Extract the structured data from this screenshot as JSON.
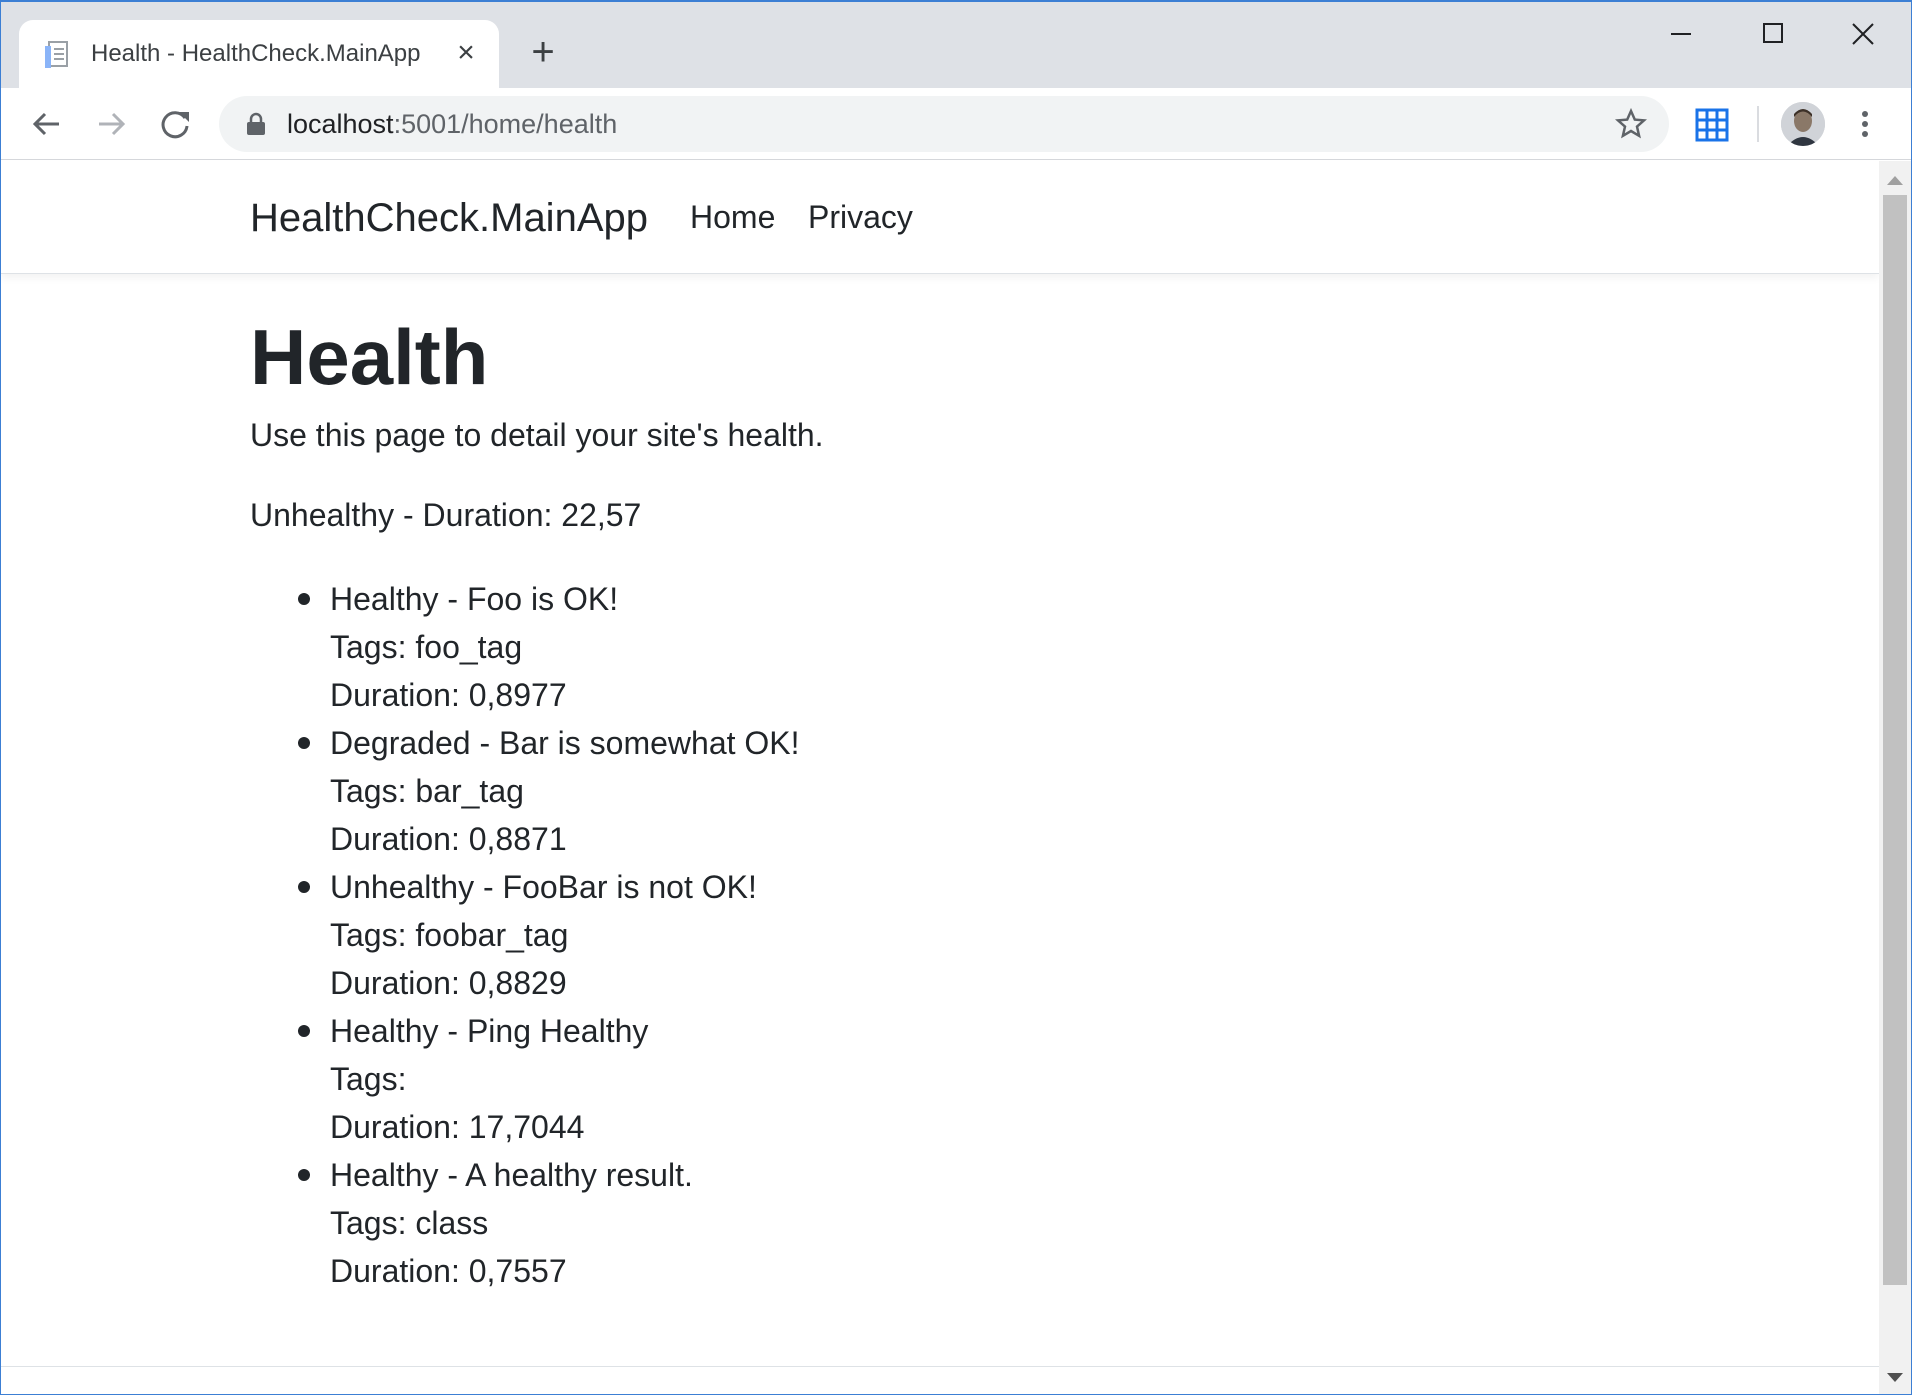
{
  "browser": {
    "tab": {
      "title": "Health - HealthCheck.MainApp",
      "favicon": "page-icon"
    },
    "url": {
      "host": "localhost",
      "path": ":5001/home/health"
    },
    "icons": [
      "back-icon",
      "forward-icon",
      "reload-icon",
      "lock-icon",
      "star-icon",
      "extension-grid-icon",
      "avatar",
      "menu-icon"
    ]
  },
  "navbar": {
    "brand": "HealthCheck.MainApp",
    "links": [
      {
        "label": "Home"
      },
      {
        "label": "Privacy"
      }
    ]
  },
  "page": {
    "title": "Health",
    "lead": "Use this page to detail your site's health.",
    "overall": "Unhealthy - Duration: 22,57",
    "checks": [
      {
        "status_line": "Healthy - Foo is OK!",
        "tags_line": "Tags: foo_tag",
        "duration_line": "Duration: 0,8977"
      },
      {
        "status_line": "Degraded - Bar is somewhat OK!",
        "tags_line": "Tags: bar_tag",
        "duration_line": "Duration: 0,8871"
      },
      {
        "status_line": "Unhealthy - FooBar is not OK!",
        "tags_line": "Tags: foobar_tag",
        "duration_line": "Duration: 0,8829"
      },
      {
        "status_line": "Healthy - Ping Healthy",
        "tags_line": "Tags:",
        "duration_line": "Duration: 17,7044"
      },
      {
        "status_line": "Healthy - A healthy result.",
        "tags_line": "Tags: class",
        "duration_line": "Duration: 0,7557"
      }
    ]
  },
  "colors": {
    "text": "#212529",
    "tabstrip": "#dee1e6",
    "omnibox": "#f1f3f4",
    "accent": "#1a73e8"
  }
}
